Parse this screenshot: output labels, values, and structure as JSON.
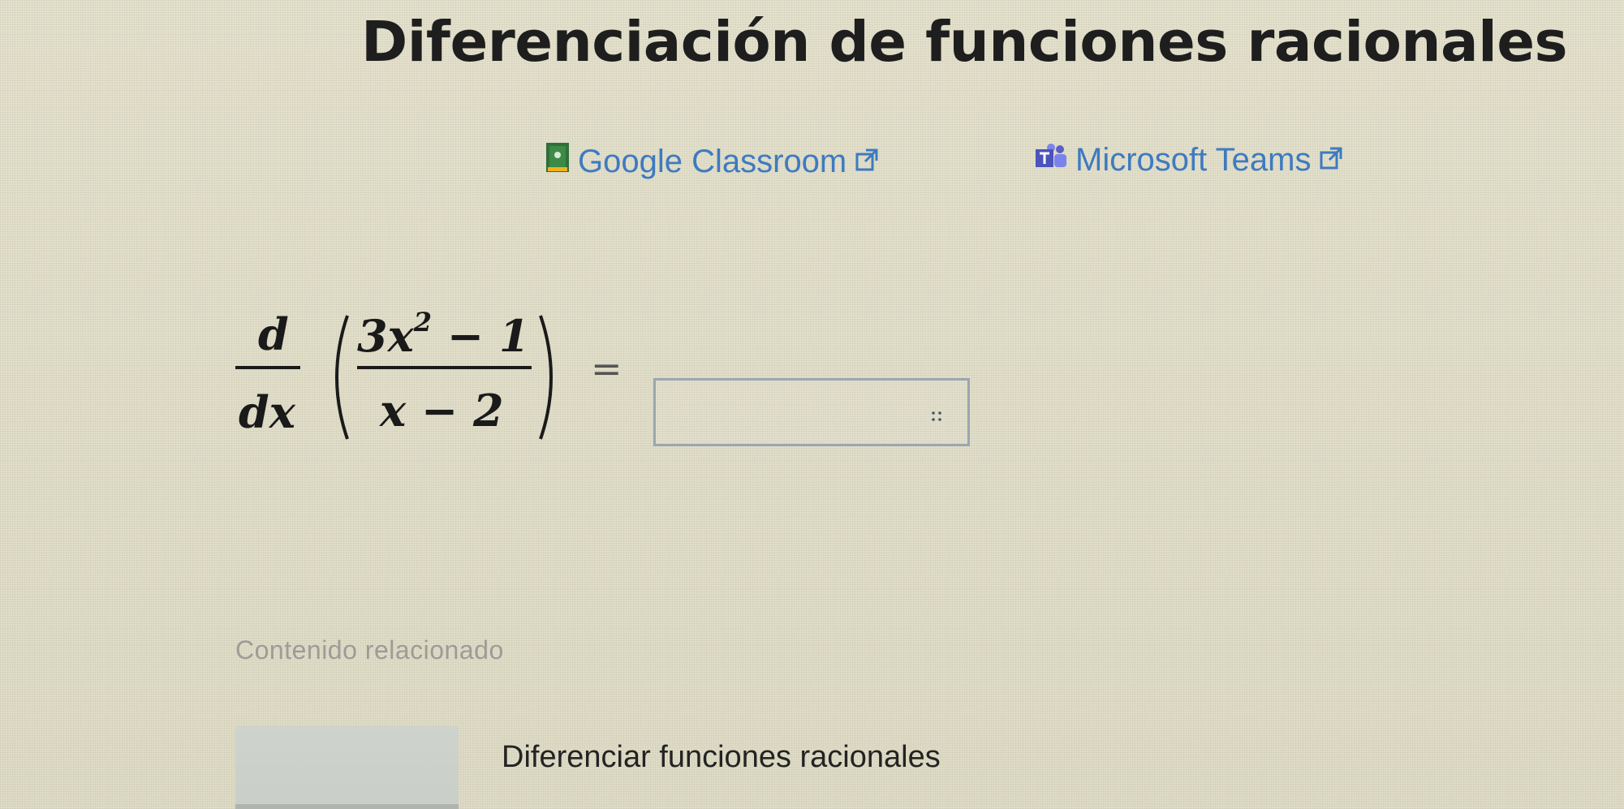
{
  "page": {
    "title": "Diferenciación de funciones racionales"
  },
  "share": {
    "classroom_label": "Google Classroom",
    "teams_label": "Microsoft Teams",
    "link_color": "#3e7ac0",
    "icons": {
      "classroom": "google-classroom-icon",
      "teams": "microsoft-teams-icon",
      "external": "external-link-icon"
    }
  },
  "problem": {
    "derivative_numerator": "d",
    "derivative_denominator": "dx",
    "fraction_numerator_base": "3x",
    "fraction_numerator_exponent": "2",
    "fraction_numerator_tail": "− 1",
    "fraction_denominator": "x − 2",
    "equals": "=",
    "answer_value": ""
  },
  "related": {
    "section_label": "Contenido relacionado",
    "items": [
      {
        "label": "Diferenciar funciones racionales"
      }
    ]
  }
}
